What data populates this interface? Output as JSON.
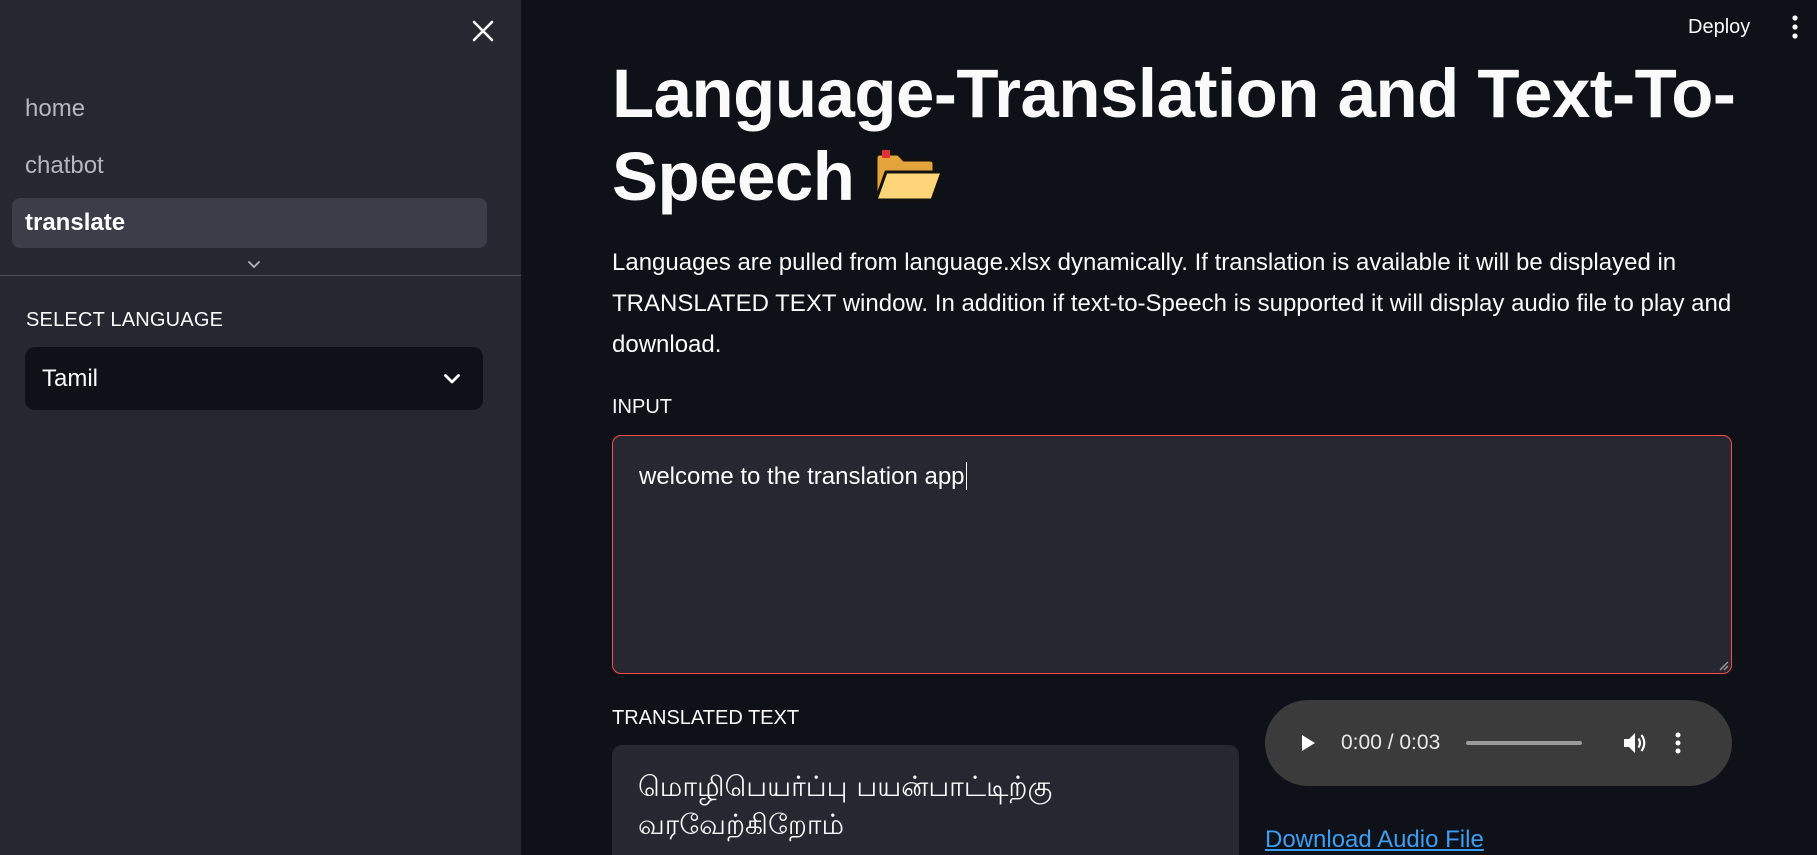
{
  "sidebar": {
    "nav_items": [
      {
        "label": "home"
      },
      {
        "label": "chatbot"
      },
      {
        "label": "translate"
      }
    ],
    "select_label": "SELECT LANGUAGE",
    "select_value": "Tamil"
  },
  "header": {
    "deploy_label": "Deploy"
  },
  "main": {
    "title": "Language-Translation and Text-To-Speech",
    "title_icon": "open-folder-emoji",
    "description": "Languages are pulled from language.xlsx dynamically. If translation is available it will be displayed in TRANSLATED TEXT window. In addition if text-to-Speech is supported it will display audio file to play and download.",
    "input_label": "INPUT",
    "input_value": "welcome to the translation app",
    "translated_label": "TRANSLATED TEXT",
    "translated_text": "மொழிபெயர்ப்பு பயன்பாட்டிற்கு வரவேற்கிறோம்",
    "audio": {
      "time": "0:00 / 0:03",
      "progress": 0
    },
    "download_label": "Download Audio File"
  },
  "colors": {
    "background": "#0e1117",
    "sidebar": "#262730",
    "accent": "#ff4b4b",
    "link": "#3d9df3"
  }
}
